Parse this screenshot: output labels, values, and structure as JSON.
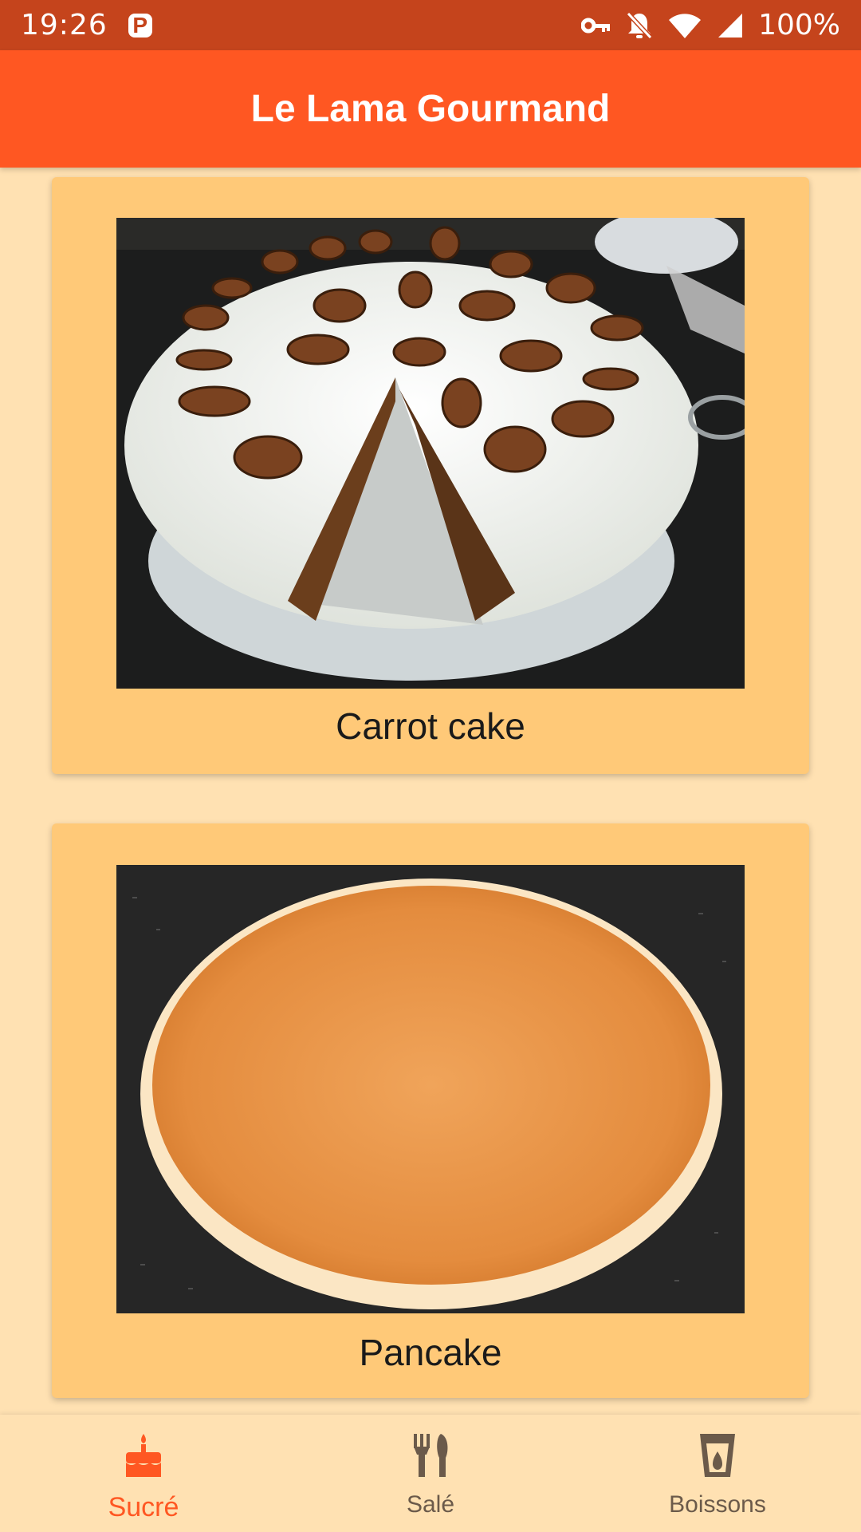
{
  "status_bar": {
    "time": "19:26",
    "battery": "100%",
    "icons": [
      "parking-p-icon",
      "key-icon",
      "bell-muted-icon",
      "wifi-icon",
      "signal-icon"
    ]
  },
  "app_bar": {
    "title": "Le Lama Gourmand"
  },
  "recipes": [
    {
      "name": "Carrot cake",
      "image": "carrot-cake-photo"
    },
    {
      "name": "Pancake",
      "image": "pancake-photo"
    }
  ],
  "bottom_nav": {
    "items": [
      {
        "label": "Sucré",
        "icon": "cake-icon",
        "active": true
      },
      {
        "label": "Salé",
        "icon": "fork-knife-icon",
        "active": false
      },
      {
        "label": "Boissons",
        "icon": "cup-icon",
        "active": false
      }
    ]
  },
  "colors": {
    "status_bar": "#c5441c",
    "app_bar": "#ff5722",
    "background": "#ffe1b2",
    "card": "#ffc978",
    "active_tab": "#ff5722",
    "inactive_tab": "#6b5a4a"
  }
}
